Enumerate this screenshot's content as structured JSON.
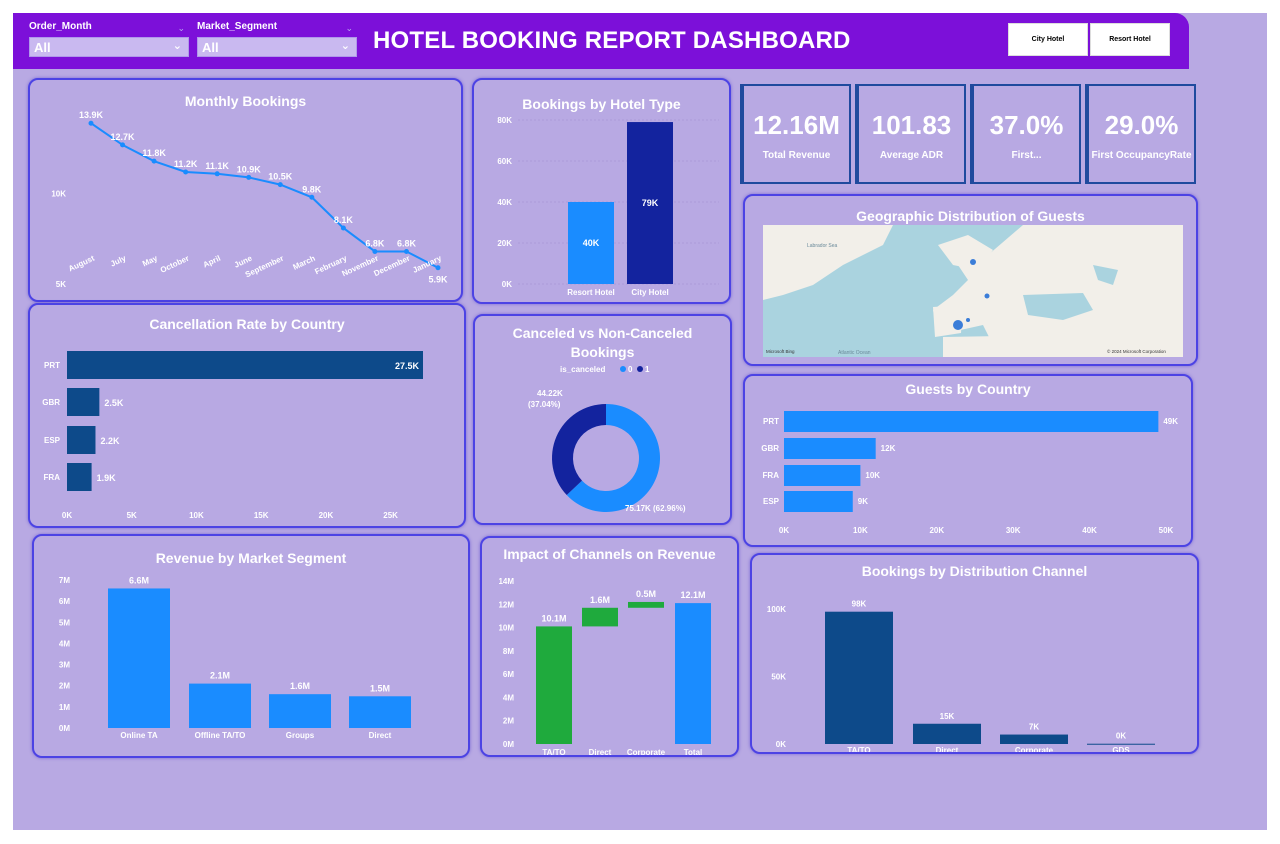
{
  "header": {
    "title": "HOTEL BOOKING REPORT DASHBOARD",
    "slicers": [
      {
        "label": "Order_Month",
        "value": "All"
      },
      {
        "label": "Market_Segment",
        "value": "All"
      }
    ],
    "buttons": [
      {
        "label": "City Hotel"
      },
      {
        "label": "Resort Hotel"
      }
    ]
  },
  "kpis": [
    {
      "value": "12.16M",
      "label": "Total Revenue"
    },
    {
      "value": "101.83",
      "label": "Average ADR"
    },
    {
      "value": "37.0%",
      "label": "First..."
    },
    {
      "value": "29.0%",
      "label": "First OccupancyRate"
    }
  ],
  "map": {
    "title": "Geographic Distribution of Guests",
    "labels": {
      "labrador": "Labrador Sea",
      "atlantic": "Atlantic Ocean",
      "bing": "Microsoft Bing",
      "copyright": "© 2024 Microsoft Corporation"
    }
  },
  "colors": {
    "bar_blue": "#1a8cff",
    "navy": "#0d4a8a",
    "dark_navy": "#13239e",
    "green": "#1faa3d",
    "line": "#1a8cff",
    "border": "#4c43e4",
    "header": "#7c10d9"
  },
  "chart_data": [
    {
      "id": "monthly",
      "type": "line",
      "title": "Monthly Bookings",
      "categories": [
        "August",
        "July",
        "May",
        "October",
        "April",
        "June",
        "September",
        "March",
        "February",
        "November",
        "December",
        "January"
      ],
      "values": [
        13.9,
        12.7,
        11.8,
        11.2,
        11.1,
        10.9,
        10.5,
        9.8,
        8.1,
        6.8,
        6.8,
        5.9
      ],
      "labels": [
        "13.9K",
        "12.7K",
        "11.8K",
        "11.2K",
        "11.1K",
        "10.9K",
        "10.5K",
        "9.8K",
        "8.1K",
        "6.8K",
        "6.8K",
        "5.9K"
      ],
      "yticks": [
        "10K",
        "5K"
      ],
      "ylim": [
        4.5,
        14.3
      ]
    },
    {
      "id": "hoteltype",
      "type": "bar",
      "title": "Bookings by Hotel Type",
      "categories": [
        "Resort Hotel",
        "City Hotel"
      ],
      "values": [
        40,
        79
      ],
      "labels": [
        "40K",
        "79K"
      ],
      "yticks": [
        "80K",
        "60K",
        "40K",
        "20K",
        "0K"
      ],
      "ylim": [
        0,
        80
      ]
    },
    {
      "id": "cancel",
      "type": "bar",
      "title": "Cancellation Rate by Country",
      "categories": [
        "PRT",
        "GBR",
        "ESP",
        "FRA"
      ],
      "values": [
        27.5,
        2.5,
        2.2,
        1.9
      ],
      "labels": [
        "27.5K",
        "2.5K",
        "2.2K",
        "1.9K"
      ],
      "xticks": [
        "0K",
        "5K",
        "10K",
        "15K",
        "20K",
        "25K"
      ],
      "xlim": [
        0,
        27.5
      ]
    },
    {
      "id": "donut",
      "type": "pie",
      "title": "Canceled vs Non-Canceled Bookings",
      "legend_title": "is_canceled",
      "legend": [
        "0",
        "1"
      ],
      "values": [
        75.17,
        44.22
      ],
      "labels": [
        "75.17K (62.96%)",
        "44.22K (37.04%)"
      ]
    },
    {
      "id": "guests",
      "type": "bar",
      "title": "Guests by Country",
      "categories": [
        "PRT",
        "GBR",
        "FRA",
        "ESP"
      ],
      "values": [
        49,
        12,
        10,
        9
      ],
      "labels": [
        "49K",
        "12K",
        "10K",
        "9K"
      ],
      "xticks": [
        "0K",
        "10K",
        "20K",
        "30K",
        "40K",
        "50K"
      ],
      "xlim": [
        0,
        50
      ]
    },
    {
      "id": "segment",
      "type": "bar",
      "title": "Revenue by Market Segment",
      "categories": [
        "Online TA",
        "Offline TA/TO",
        "Groups",
        "Direct"
      ],
      "values": [
        6.6,
        2.1,
        1.6,
        1.5
      ],
      "labels": [
        "6.6M",
        "2.1M",
        "1.6M",
        "1.5M"
      ],
      "yticks": [
        "7M",
        "6M",
        "5M",
        "4M",
        "3M",
        "2M",
        "1M",
        "0M"
      ],
      "ylim": [
        0,
        7
      ]
    },
    {
      "id": "waterfall",
      "type": "bar",
      "title": "Impact of Channels on Revenue",
      "categories": [
        "TA/TO",
        "Direct",
        "Corporate",
        "Total"
      ],
      "values": [
        10.1,
        1.6,
        0.5,
        12.1
      ],
      "labels": [
        "10.1M",
        "1.6M",
        "0.5M",
        "12.1M"
      ],
      "yticks": [
        "14M",
        "12M",
        "10M",
        "8M",
        "6M",
        "4M",
        "2M",
        "0M"
      ],
      "ylim": [
        0,
        14
      ]
    },
    {
      "id": "distribution",
      "type": "bar",
      "title": "Bookings by Distribution Channel",
      "categories": [
        "TA/TO",
        "Direct",
        "Corporate",
        "GDS"
      ],
      "values": [
        98,
        15,
        7,
        0.2
      ],
      "labels": [
        "98K",
        "15K",
        "7K",
        "0K"
      ],
      "yticks": [
        "100K",
        "50K",
        "0K"
      ],
      "ylim": [
        0,
        100
      ]
    }
  ]
}
